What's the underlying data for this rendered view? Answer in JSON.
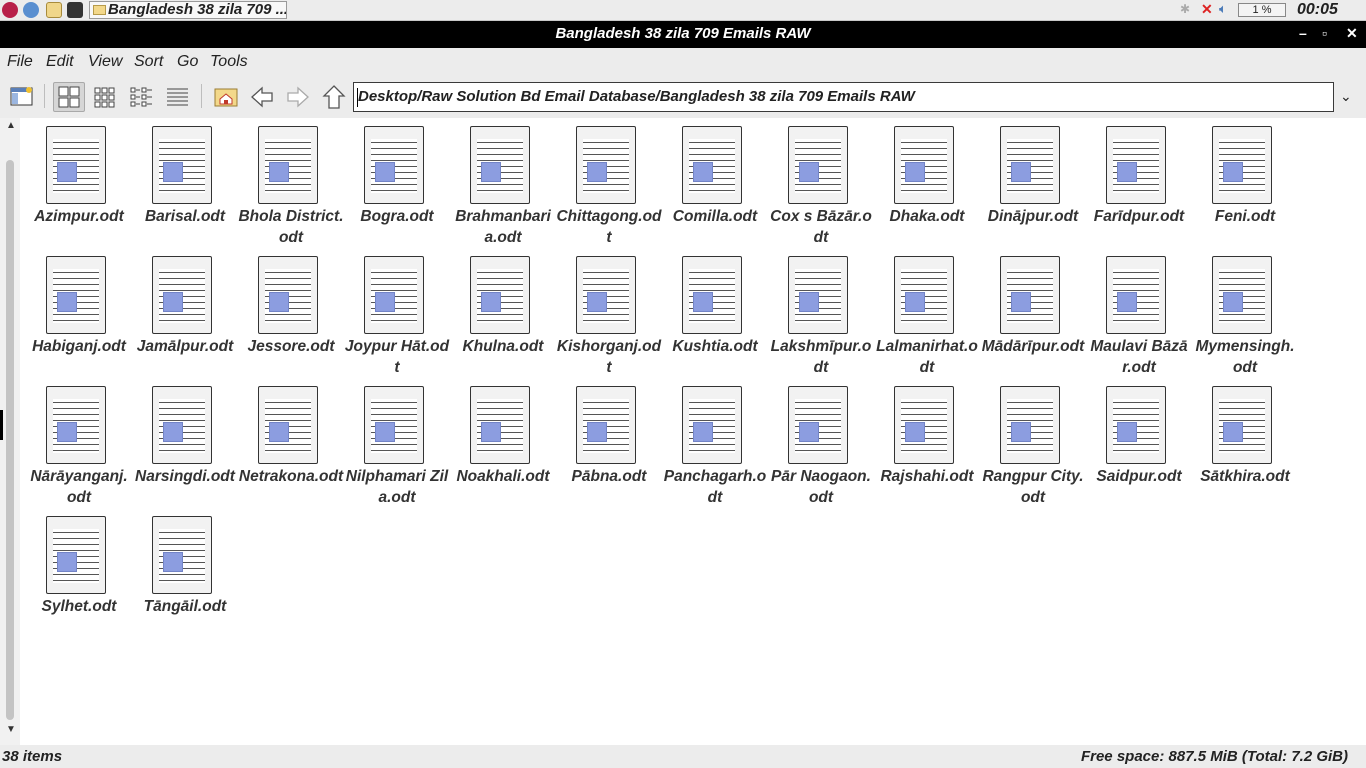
{
  "taskbar": {
    "task_title": "Bangladesh 38 zila 709 ...",
    "cpu": "1 %",
    "clock": "00:05"
  },
  "window": {
    "title": "Bangladesh 38 zila 709 Emails RAW",
    "min": "–",
    "max": "▫",
    "close": "✕"
  },
  "menu": [
    "File",
    "Edit",
    "View",
    "Sort",
    "Go",
    "Tools"
  ],
  "toolbar": {
    "path": "Desktop/Raw Solution Bd Email  Database/Bangladesh 38 zila 709 Emails RAW"
  },
  "files": [
    "Azimpur.odt",
    "Barisal.odt",
    "Bhola District.odt",
    "Bogra.odt",
    "Brahmanbaria.odt",
    "Chittagong.odt",
    "Comilla.odt",
    "Cox s Bāzār.odt",
    "Dhaka.odt",
    "Dinājpur.odt",
    "Farīdpur.odt",
    "Feni.odt",
    "Habiganj.odt",
    "Jamālpur.odt",
    "Jessore.odt",
    "Joypur Hāt.odt",
    "Khulna.odt",
    "Kishorganj.odt",
    "Kushtia.odt",
    "Lakshmīpur.odt",
    "Lalmanirhat.odt",
    "Mādārīpur.odt",
    "Maulavi Bāzār.odt",
    "Mymensingh.odt",
    "Nārāyanganj.odt",
    "Narsingdi.odt",
    "Netrakona.odt",
    "Nilphamari Zila.odt",
    "Noakhali.odt",
    "Pābna.odt",
    "Panchagarh.odt",
    "Pār Naogaon.odt",
    "Rajshahi.odt",
    "Rangpur City.odt",
    "Saidpur.odt",
    "Sātkhira.odt",
    "Sylhet.odt",
    "Tāngāil.odt"
  ],
  "status": {
    "items": "38 items",
    "free": "Free space: 887.5 MiB (Total: 7.2 GiB)"
  }
}
